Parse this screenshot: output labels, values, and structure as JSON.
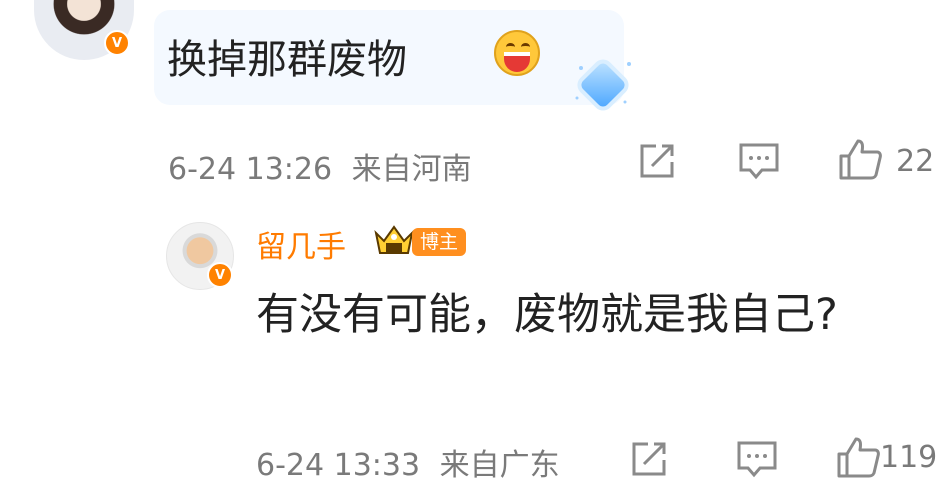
{
  "comment1": {
    "text": "换掉那群废物",
    "emoji": "grinning-face-emoji",
    "meta": {
      "time": "6-24 13:26",
      "location": "来自河南",
      "like_count": "22"
    }
  },
  "reply": {
    "username": "留几手",
    "badge": "博主",
    "text": "有没有可能，废物就是我自己?",
    "meta": {
      "time": "6-24 13:33",
      "location": "来自广东",
      "like_count": "119"
    }
  },
  "colors": {
    "accent": "#ff8200",
    "username": "#ff7b00",
    "meta": "#7a7a7a",
    "bubble": "#f4f9ff"
  },
  "icons": [
    "verified-v-icon",
    "share-icon",
    "comment-icon",
    "like-icon",
    "crown-level-icon",
    "diamond-gem-icon"
  ]
}
